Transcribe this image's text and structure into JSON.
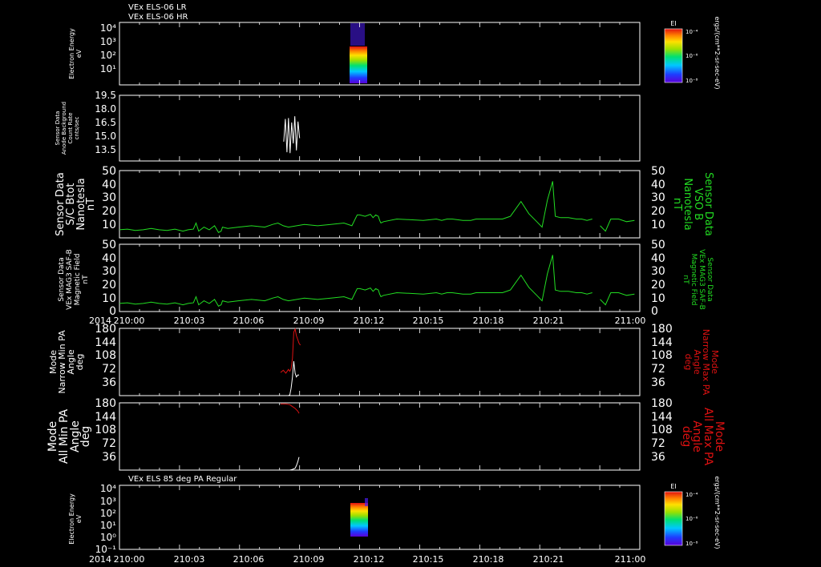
{
  "header": {
    "line1": "VEx ELS-06 LR",
    "line2": "VEx ELS-06 HR"
  },
  "x_axis": {
    "year": "2014",
    "ticks": [
      "210:00",
      "210:03",
      "210:06",
      "210:09",
      "210:12",
      "210:15",
      "210:18",
      "210:21",
      "211:00"
    ]
  },
  "colors": {
    "background": "#000000",
    "axes": "#ffffff",
    "green_trace": "#22dd22",
    "red_trace": "#dd1111",
    "white_trace": "#ffffff"
  },
  "chart_data": [
    {
      "id": "els_lr_hr",
      "type": "heatmap",
      "ylabel": [
        "Electron Energy",
        "eV"
      ],
      "scale": "log",
      "ylim": [
        1,
        10000
      ],
      "yticks": [
        "10⁴",
        "10³",
        "10²",
        "10¹"
      ],
      "x_span": [
        210.61,
        210.68
      ],
      "energy_span": [
        1.5,
        10000
      ],
      "colorbar": {
        "title": "EI",
        "ticks": [
          "10⁻⁴",
          "10⁻⁶",
          "10⁻⁸"
        ],
        "units": "ergs/(cm**2-sr-sec-eV)"
      }
    },
    {
      "id": "anode_bg",
      "type": "line",
      "ylabel": [
        "Sensor Data",
        "Anode Background",
        "Count Rate",
        "cnts/sec"
      ],
      "ylim": [
        12,
        19.5
      ],
      "yticks": [
        "19.5",
        "18.0",
        "16.5",
        "15.0",
        "13.5"
      ],
      "series": [
        {
          "color": "white",
          "x": [
            210.622,
            210.628,
            210.634,
            210.64,
            210.646,
            210.652,
            210.658,
            210.664,
            210.67,
            210.676,
            210.682
          ],
          "y": [
            14.2,
            16.8,
            13.0,
            16.9,
            12.9,
            16.4,
            14.0,
            17.1,
            13.2,
            16.5,
            14.6
          ]
        }
      ]
    },
    {
      "id": "bmag_sc",
      "type": "line",
      "ylabel": [
        "Sensor Data",
        "S/C Btot",
        "Nanotesla",
        "nT"
      ],
      "ylabel_right": [
        "Sensor Data",
        "VSO B",
        "Nanotesla",
        "nT"
      ],
      "ylim": [
        0,
        50
      ],
      "yticks": [
        "50",
        "40",
        "30",
        "20",
        "10"
      ],
      "gaps_after": [
        7
      ],
      "series": [
        {
          "color": "green",
          "x": [
            210.0,
            210.03,
            210.06,
            210.09,
            210.12,
            210.15,
            210.18,
            210.21,
            210.24,
            210.26,
            210.28,
            210.29,
            210.3,
            210.32,
            210.34,
            210.36,
            210.375,
            210.385,
            210.39,
            210.41,
            210.45,
            210.5,
            210.55,
            210.58,
            210.6,
            210.62,
            210.64,
            210.7,
            210.75,
            210.8,
            210.85,
            210.88,
            210.9,
            210.91,
            210.93,
            210.95,
            210.96,
            210.97,
            210.98,
            210.985,
            210.99,
            211.0,
            211.05,
            211.15,
            211.2,
            211.22,
            211.24,
            211.26,
            211.3,
            211.32,
            211.33,
            211.35,
            211.37,
            211.39,
            211.42,
            211.45,
            211.48,
            211.52,
            211.55,
            211.58,
            211.6,
            211.62,
            211.64,
            211.65,
            211.67,
            211.7,
            211.73,
            211.75,
            211.77,
            211.79
          ],
          "y": [
            6,
            6.5,
            5.5,
            6,
            7,
            6,
            5.5,
            6.5,
            5,
            6,
            6.5,
            11,
            5,
            8,
            6,
            9,
            4,
            5,
            8,
            7,
            8,
            9,
            8,
            10,
            11,
            9,
            8,
            10,
            9,
            10,
            11,
            9,
            17,
            17,
            16,
            17.5,
            15,
            17,
            16,
            13,
            11,
            12,
            14,
            13,
            14,
            13,
            14,
            14,
            13,
            13,
            13,
            14,
            14,
            14,
            14,
            14,
            16,
            27,
            18,
            12,
            8,
            28,
            42,
            16,
            15,
            15,
            14,
            14,
            13,
            14
          ]
        },
        {
          "color": "green",
          "x": [
            211.82,
            211.84,
            211.86,
            211.89,
            211.92,
            211.95
          ],
          "y": [
            9,
            5,
            14,
            14,
            12,
            13
          ]
        }
      ]
    },
    {
      "id": "bmag_mag3",
      "type": "line",
      "ylabel": [
        "Sensor Data",
        "VEx MAG3 SAF-B",
        "Magnetic Field",
        "nT"
      ],
      "ylabel_right": [
        "Sensor Data",
        "VEx MAG3 SAF-B",
        "Magnetic Field",
        "nT"
      ],
      "ylim": [
        0,
        50
      ],
      "yticks": [
        "50",
        "40",
        "30",
        "20",
        "10",
        "0"
      ],
      "gaps_after": [
        7
      ],
      "series": [
        {
          "color": "green",
          "x": [
            210.0,
            210.03,
            210.06,
            210.09,
            210.12,
            210.15,
            210.18,
            210.21,
            210.24,
            210.26,
            210.28,
            210.29,
            210.3,
            210.32,
            210.34,
            210.36,
            210.375,
            210.385,
            210.39,
            210.41,
            210.45,
            210.5,
            210.55,
            210.58,
            210.6,
            210.62,
            210.64,
            210.7,
            210.75,
            210.8,
            210.85,
            210.88,
            210.9,
            210.91,
            210.93,
            210.95,
            210.96,
            210.97,
            210.98,
            210.985,
            210.99,
            211.0,
            211.05,
            211.15,
            211.2,
            211.22,
            211.24,
            211.26,
            211.3,
            211.32,
            211.33,
            211.35,
            211.37,
            211.39,
            211.42,
            211.45,
            211.48,
            211.52,
            211.55,
            211.58,
            211.6,
            211.62,
            211.64,
            211.65,
            211.67,
            211.7,
            211.73,
            211.75,
            211.77,
            211.79
          ],
          "y": [
            6,
            6.5,
            5.5,
            6,
            7,
            6,
            5.5,
            6.5,
            5,
            6,
            6.5,
            11,
            5,
            8,
            6,
            9,
            4,
            5,
            8,
            7,
            8,
            9,
            8,
            10,
            11,
            9,
            8,
            10,
            9,
            10,
            11,
            9,
            17,
            17,
            16,
            17.5,
            15,
            17,
            16,
            13,
            11,
            12,
            14,
            13,
            14,
            13,
            14,
            14,
            13,
            13,
            13,
            14,
            14,
            14,
            14,
            14,
            16,
            27,
            18,
            12,
            8,
            28,
            42,
            16,
            15,
            15,
            14,
            14,
            13,
            14
          ]
        },
        {
          "color": "green",
          "x": [
            211.82,
            211.84,
            211.86,
            211.89,
            211.92,
            211.95
          ],
          "y": [
            9,
            5,
            14,
            14,
            12,
            13
          ]
        }
      ]
    },
    {
      "id": "narrow_pa",
      "type": "line",
      "ylabel": [
        "Mode",
        "Narrow Min PA",
        "Angle",
        "deg"
      ],
      "ylabel_right": [
        "Mode",
        "Narrow Max PA",
        "Angle",
        "deg"
      ],
      "ylim": [
        0,
        180
      ],
      "yticks": [
        "180",
        "144",
        "108",
        "72",
        "36"
      ],
      "series": [
        {
          "color": "red",
          "x": [
            210.61,
            210.62,
            210.63,
            210.64,
            210.645,
            210.65,
            210.655,
            210.66,
            210.665,
            210.67,
            210.675,
            210.68,
            210.685
          ],
          "y": [
            62,
            68,
            60,
            70,
            65,
            72,
            100,
            170,
            178,
            160,
            150,
            140,
            135
          ]
        },
        {
          "color": "white",
          "x": [
            210.61,
            210.64,
            210.645,
            210.65,
            210.655,
            210.66,
            210.665,
            210.67,
            210.675,
            210.68
          ],
          "y": [
            0,
            0,
            2,
            20,
            50,
            92,
            60,
            50,
            55,
            55
          ]
        }
      ]
    },
    {
      "id": "all_pa",
      "type": "line",
      "ylabel": [
        "Mode",
        "All Min PA",
        "Angle",
        "deg"
      ],
      "ylabel_right": [
        "Mode",
        "All Max PA",
        "Angle",
        "deg"
      ],
      "ylim": [
        0,
        180
      ],
      "yticks": [
        "180",
        "144",
        "108",
        "72",
        "36"
      ],
      "series": [
        {
          "color": "red",
          "x": [
            210.61,
            210.63,
            210.645,
            210.655,
            210.665,
            210.675,
            210.68
          ],
          "y": [
            177,
            177,
            175,
            170,
            165,
            158,
            152
          ]
        },
        {
          "color": "white",
          "x": [
            210.61,
            210.645,
            210.655,
            210.665,
            210.67,
            210.675,
            210.68
          ],
          "y": [
            0,
            0,
            2,
            5,
            12,
            22,
            35
          ]
        }
      ]
    },
    {
      "id": "els_85",
      "type": "heatmap",
      "title": "VEx ELS 85 deg PA Regular",
      "ylabel": [
        "Electron Energy",
        "eV"
      ],
      "scale": "log",
      "ylim": [
        0.1,
        10000
      ],
      "yticks": [
        "10⁴",
        "10³",
        "10²",
        "10¹",
        "10⁰",
        "10⁻¹"
      ],
      "x_span": [
        210.62,
        210.68
      ],
      "energy_span": [
        1,
        2000
      ],
      "colorbar": {
        "title": "EI",
        "ticks": [
          "10⁻⁴",
          "10⁻⁶",
          "10⁻⁸"
        ],
        "units": "ergs/(cm**2-sr-sec-eV)"
      }
    }
  ]
}
